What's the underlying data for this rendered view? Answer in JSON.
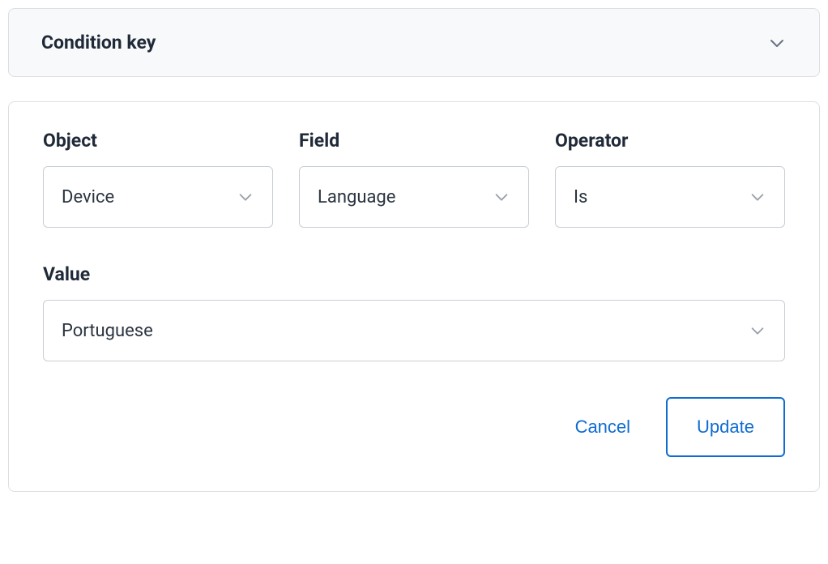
{
  "accordion": {
    "title": "Condition key"
  },
  "form": {
    "object": {
      "label": "Object",
      "value": "Device"
    },
    "field": {
      "label": "Field",
      "value": "Language"
    },
    "operator": {
      "label": "Operator",
      "value": "Is"
    },
    "value": {
      "label": "Value",
      "value": "Portuguese"
    }
  },
  "actions": {
    "cancel": "Cancel",
    "update": "Update"
  }
}
